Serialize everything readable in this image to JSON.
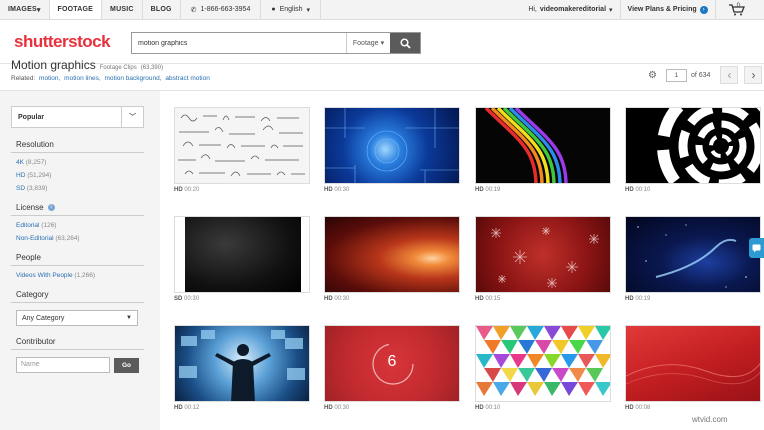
{
  "topbar": {
    "nav": [
      "IMAGES",
      "FOOTAGE",
      "MUSIC",
      "BLOG"
    ],
    "phone": "1-866-663-3954",
    "language": "English",
    "greeting": "Hi,",
    "username": "videomakereditorial",
    "plans": "View Plans & Pricing",
    "cart_count": "0"
  },
  "header": {
    "logo": "shutterstock",
    "search_value": "motion graphics",
    "search_type": "Footage"
  },
  "title": {
    "heading": "Motion graphics",
    "subtitle": "Footage Clips",
    "count": "(63,390)"
  },
  "related": {
    "label": "Related:",
    "links": [
      "motion,",
      "motion lines,",
      "motion background,",
      "abstract motion"
    ]
  },
  "pager": {
    "current": "1",
    "total": "of 634"
  },
  "sidebar": {
    "sort": "Popular",
    "resolution_title": "Resolution",
    "resolution": [
      {
        "label": "4K",
        "count": "(8,257)"
      },
      {
        "label": "HD",
        "count": "(51,294)"
      },
      {
        "label": "SD",
        "count": "(3,839)"
      }
    ],
    "license_title": "License",
    "license": [
      {
        "label": "Editorial",
        "count": "(126)"
      },
      {
        "label": "Non-Editorial",
        "count": "(63,264)"
      }
    ],
    "people_title": "People",
    "people": [
      {
        "label": "Videos With People",
        "count": "(1,266)"
      }
    ],
    "category_title": "Category",
    "category_value": "Any Category",
    "contributor_title": "Contributor",
    "contributor_placeholder": "Name",
    "go_label": "Go"
  },
  "clips": [
    {
      "res": "HD",
      "time": "00:20",
      "art": "math"
    },
    {
      "res": "HD",
      "time": "00:30",
      "art": "tech"
    },
    {
      "res": "HD",
      "time": "00:19",
      "art": "ribbons"
    },
    {
      "res": "HD",
      "time": "00:10",
      "art": "rings"
    },
    {
      "res": "SD",
      "time": "00:30",
      "art": "dark"
    },
    {
      "res": "HD",
      "time": "00:30",
      "art": "fire"
    },
    {
      "res": "HD",
      "time": "00:15",
      "art": "snow"
    },
    {
      "res": "HD",
      "time": "00:19",
      "art": "space"
    },
    {
      "res": "HD",
      "time": "00:12",
      "art": "screens"
    },
    {
      "res": "HD",
      "time": "00:30",
      "art": "countdown",
      "text": "6"
    },
    {
      "res": "HD",
      "time": "00:10",
      "art": "triangles"
    },
    {
      "res": "HD",
      "time": "00:08",
      "art": "redwave"
    }
  ],
  "watermark": "wtvid.com",
  "colors": {
    "brand_red": "#e9313e",
    "link_blue": "#2a6fb0",
    "sidebar_bg": "#f4f4f4"
  }
}
